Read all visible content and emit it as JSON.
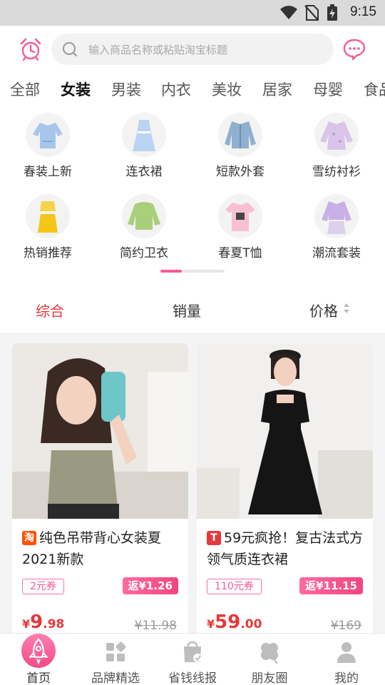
{
  "status_bar": {
    "time": "9:15",
    "icons": [
      "wifi-icon",
      "no-sim-icon",
      "battery-charging-icon"
    ]
  },
  "search": {
    "placeholder": "输入商品名称或粘贴淘宝标题",
    "left_icon": "alarm-clock-icon",
    "right_icon": "chat-bubble-icon"
  },
  "category_tabs": [
    {
      "label": "全部",
      "active": false
    },
    {
      "label": "女装",
      "active": true
    },
    {
      "label": "男装",
      "active": false
    },
    {
      "label": "内衣",
      "active": false
    },
    {
      "label": "美妆",
      "active": false
    },
    {
      "label": "居家",
      "active": false
    },
    {
      "label": "母婴",
      "active": false
    },
    {
      "label": "食品",
      "active": false
    }
  ],
  "subcategories": [
    {
      "label": "春装上新"
    },
    {
      "label": "连衣裙"
    },
    {
      "label": "短款外套"
    },
    {
      "label": "雪纺衬衫"
    },
    {
      "label": "热销推荐"
    },
    {
      "label": "简约卫衣"
    },
    {
      "label": "春夏T恤"
    },
    {
      "label": "潮流套装"
    }
  ],
  "pager": {
    "current_page": 1,
    "total_pages": 3
  },
  "sort": {
    "comprehensive": "综合",
    "sales": "销量",
    "price": "价格"
  },
  "products": [
    {
      "platform": "淘",
      "platform_color": "#ff5000",
      "title": "纯色吊带背心女装夏2021新款",
      "coupon": "2元券",
      "rebate": "返¥1.26",
      "price_currency": "¥",
      "price_int": "9",
      "price_dec": ".98",
      "original_price": "¥11.98"
    },
    {
      "platform": "T",
      "platform_color": "#e4393c",
      "title": "59元疯抢！复古法式方领气质连衣裙",
      "coupon": "110元券",
      "rebate": "返¥11.15",
      "price_currency": "¥",
      "price_int": "59",
      "price_dec": ".00",
      "original_price": "¥169"
    }
  ],
  "bottom_nav": [
    {
      "label": "首页",
      "icon": "rocket-icon",
      "active": true
    },
    {
      "label": "品牌精选",
      "icon": "grid-icon",
      "active": false
    },
    {
      "label": "省钱线报",
      "icon": "shopping-bag-icon",
      "active": false
    },
    {
      "label": "朋友圈",
      "icon": "clover-icon",
      "active": false
    },
    {
      "label": "我的",
      "icon": "user-icon",
      "active": false
    }
  ],
  "colors": {
    "accent_pink": "#f45a9c",
    "price_red": "#e4393c"
  }
}
